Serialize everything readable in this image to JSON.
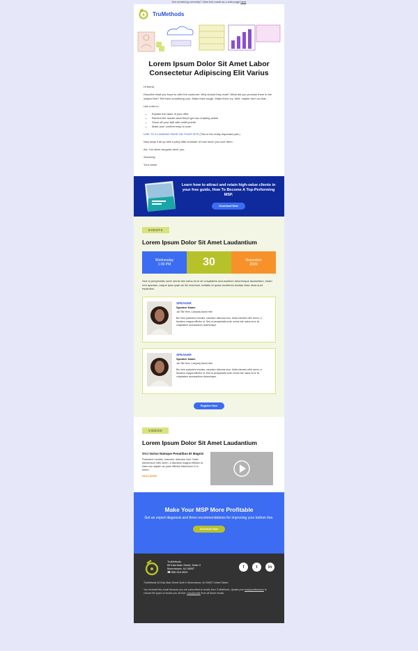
{
  "preheader": {
    "text": "Not rendering correctly? View this email as a web page",
    "link": "here"
  },
  "brand": {
    "name": "TruMethods"
  },
  "hero": {
    "title": "Lorem Ipsum Dolor Sit Amet Labor Consectetur Adipiscing Elit Varius"
  },
  "body": {
    "greeting": "Hi friend,",
    "p1": "Describe what you have to offer the customer. Why should they read? What did you promise them in the subject line? Tell them something cool. Make them laugh. Make them cry. Well, maybe don't do that…",
    "list_intro": "Use a list to:",
    "bullets": [
      "Explain the value of your offer",
      "Remind the reader what they'll get out of taking action",
      "Show off your skill with bullet points",
      "Make your content easy to scan"
    ],
    "link_text": "LINK TO A LANDING PAGE ON YOUR SITE",
    "link_note": " (This is the really important part.)",
    "p2": "Now wrap it all up with a pithy little reminder of how much you love them.",
    "p3": "Aw. You silver-tongued devil, you.",
    "signoff": "Sincerely,",
    "name": "Your name"
  },
  "guide": {
    "text": "Learn how to attract and retain high-value clients in your free guide, How To Become A Top-Performing MSP.",
    "button": "Download Now"
  },
  "events": {
    "pill": "EVENTS",
    "title": "Lorem Ipsum Dolor Sit Amet Laudantium",
    "day": "Wednesday",
    "time": "1:00 PM",
    "date": "30",
    "month": "November",
    "year": "2020",
    "desc": "Sed ut perspiciatis unde omnis iste natus error sit voluptatem accusantium doloremque laudantium, totam rem aperiam, eaque ipsa quae ab illo inventore veritatis et quasi architecto beatae vitae dicta sunt explicabo.",
    "speakers": [
      {
        "label": "SPEAKER",
        "name": "Speaker Name",
        "job": "Job Title Here, Company Name Here",
        "bio": "Bio here parturient montes, nascetur ridiculus mus. Nulla element nibh lorem, a faucibus magna efficitur ut. Sed ut perspiciatis unde omnis iste natus error sit voluptatem accusantium doloremque."
      },
      {
        "label": "SPEAKER",
        "name": "Speaker Name",
        "job": "Job Title Here, Company Name Here",
        "bio": "Bio here parturient montes, nascetur ridiculus mus. Nulla element nibh lorem, a faucibus magna efficitur ut. Sed ut perspiciatis unde omnis iste natus error sit voluptatem accusantium doloremque."
      }
    ],
    "register": "Register Now"
  },
  "videos": {
    "pill": "VIDEOS",
    "title": "Lorem Ipsum Dolor Sit Amet Laudantium",
    "item_title": "Orci Varius Natoque Penatibus Et Magnis",
    "item_body": "Parturient montes, nascetur ridiculus mus. Nulla elementum nibh lorem, a faucibus magna efficitur ut. Nam non sapien ac justo efficitur bibendum in in lorem.",
    "read_more": "READ MORE"
  },
  "cta": {
    "heading": "Make Your MSP More Profitable",
    "sub": "Get an expert diagnosis and three recommendations for improving your bottom line.",
    "button": "Schedule Now"
  },
  "footer": {
    "company": "TruMethods",
    "addr1": "65 East Main Street, Suite H",
    "addr2": "Moorestown, NJ 08057",
    "phone": "856-316-4000",
    "line": "TruMethods     65 East Main Street   Suite H   Moorestown,   NJ     08057     United States",
    "note_a": "You received this email because you are subscribed to emails from TruMethods. Update your ",
    "pref": "email preferences",
    "note_b": " to choose the types of emails you receive. ",
    "unsub": "Unsubscribe",
    "note_c": " from all future emails"
  }
}
